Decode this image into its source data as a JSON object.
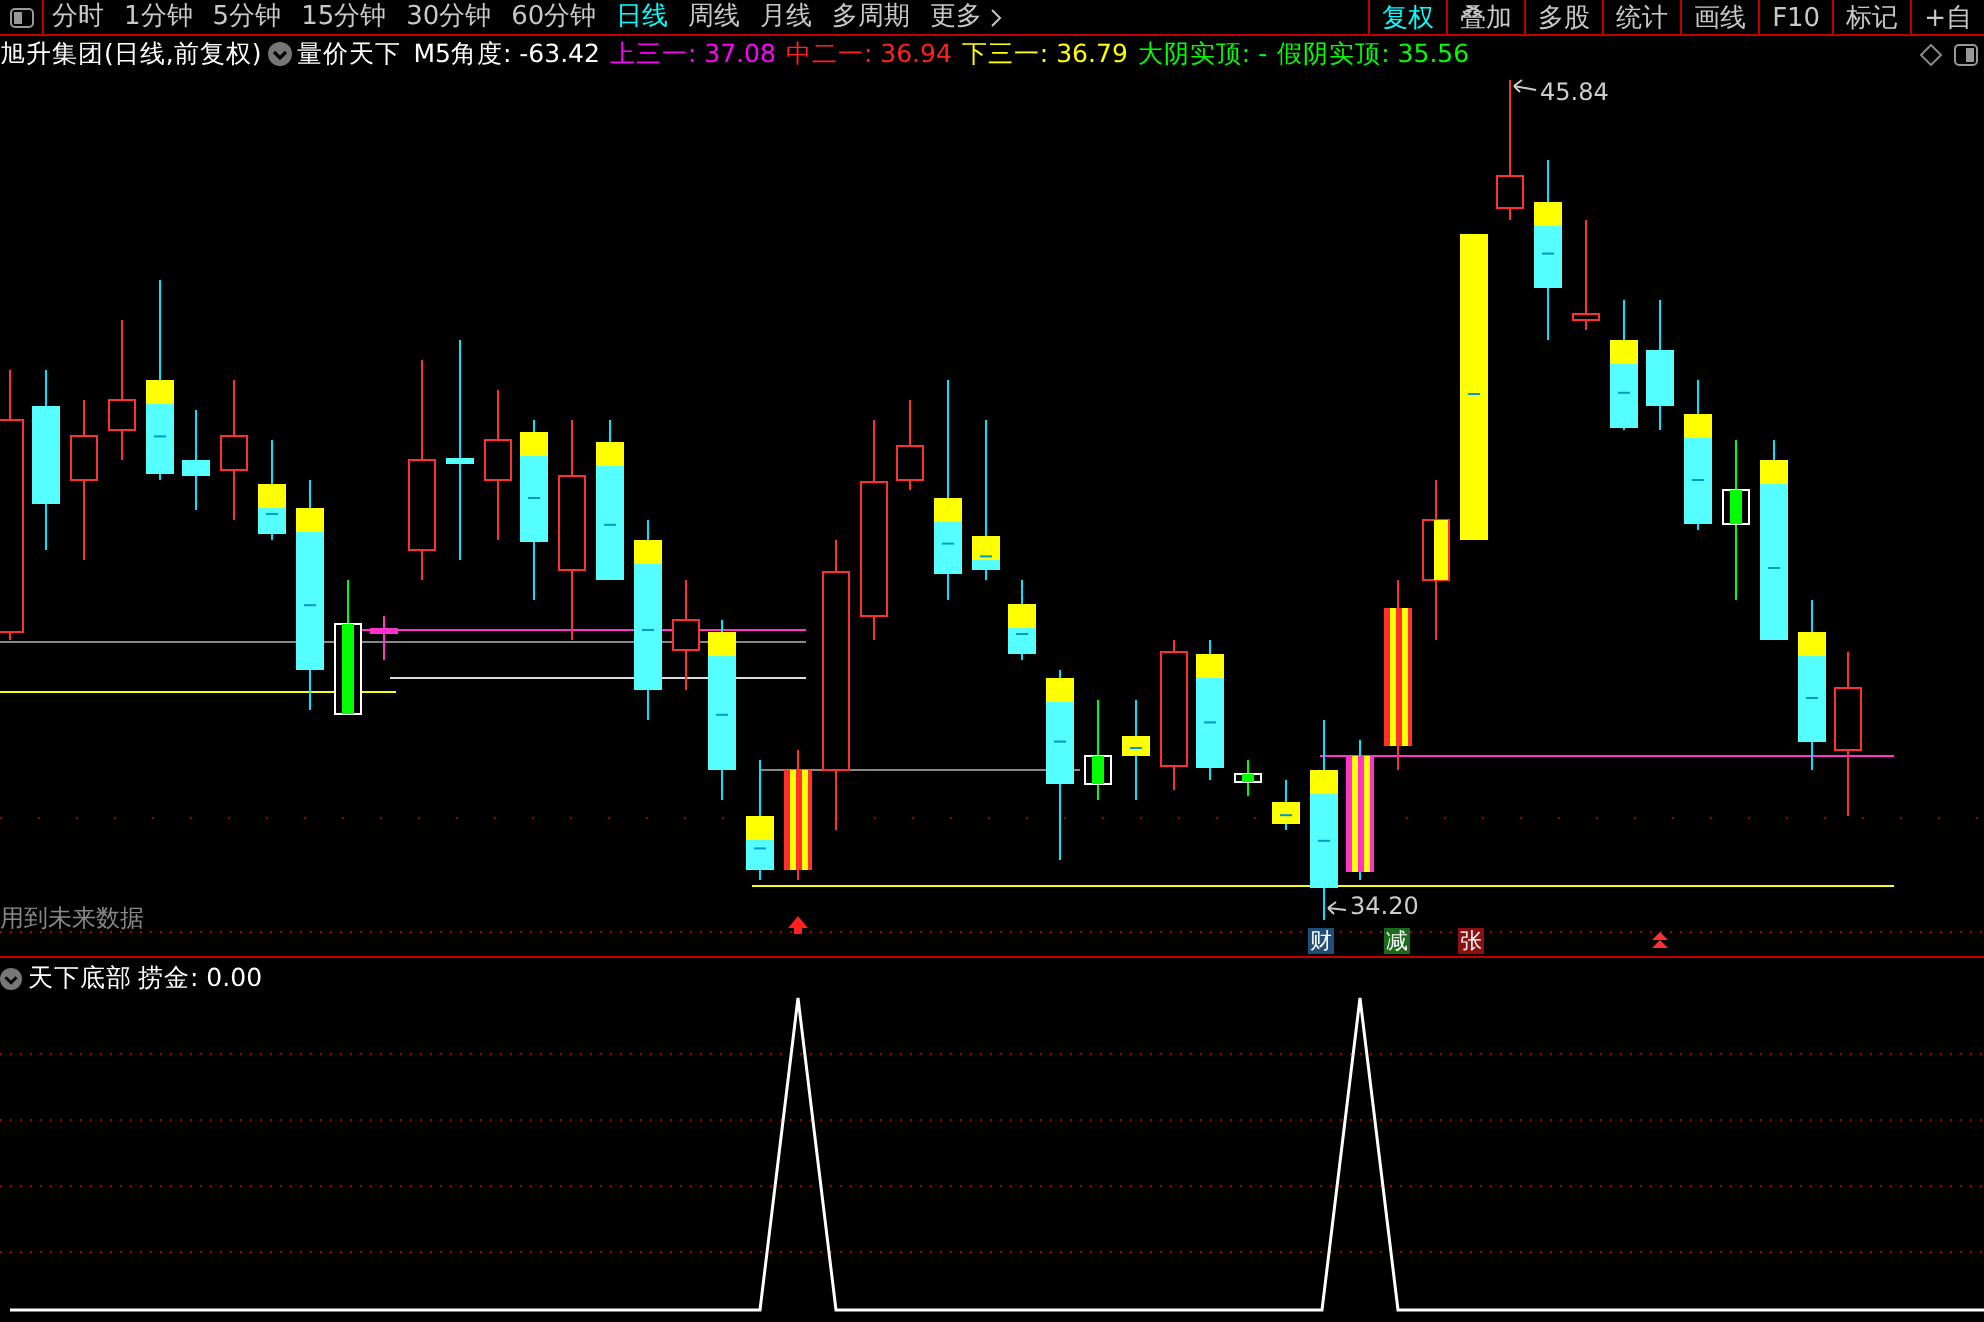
{
  "period_tabs": [
    {
      "label": "分时",
      "selected": false
    },
    {
      "label": "1分钟",
      "selected": false
    },
    {
      "label": "5分钟",
      "selected": false
    },
    {
      "label": "15分钟",
      "selected": false
    },
    {
      "label": "30分钟",
      "selected": false
    },
    {
      "label": "60分钟",
      "selected": false
    },
    {
      "label": "日线",
      "selected": true
    },
    {
      "label": "周线",
      "selected": false
    },
    {
      "label": "月线",
      "selected": false
    },
    {
      "label": "多周期",
      "selected": false
    },
    {
      "label": "更多",
      "selected": false
    }
  ],
  "tool_buttons": [
    {
      "label": "复权",
      "selected": true
    },
    {
      "label": "叠加",
      "selected": false
    },
    {
      "label": "多股",
      "selected": false
    },
    {
      "label": "统计",
      "selected": false
    },
    {
      "label": "画线",
      "selected": false
    },
    {
      "label": "F10",
      "selected": false
    },
    {
      "label": "标记",
      "selected": false
    },
    {
      "label": "+自",
      "selected": false
    }
  ],
  "info_line": {
    "title": "旭升集团(日线,前复权)",
    "indicator": "量价天下",
    "values": [
      {
        "label": "M5角度:",
        "value": "-63.42",
        "color": "#ffffff"
      },
      {
        "label": "上三一:",
        "value": "37.08",
        "color": "#ff00ff"
      },
      {
        "label": "中二一:",
        "value": "36.94",
        "color": "#ff2020"
      },
      {
        "label": "下三一:",
        "value": "36.79",
        "color": "#ffff00"
      },
      {
        "label": "大阴实顶:",
        "value": "-",
        "color": "#00ff00"
      },
      {
        "label": "假阴实顶:",
        "value": "35.56",
        "color": "#00ff00"
      }
    ]
  },
  "main_chart": {
    "high_label": "45.84",
    "low_label": "34.20",
    "note": "用到未来数据",
    "signals": [
      {
        "label": "财",
        "color": "#1f4e79"
      },
      {
        "label": "减",
        "color": "#1b6b1b"
      },
      {
        "label": "张",
        "color": "#8b1010"
      }
    ]
  },
  "sub_chart": {
    "name": "天下底部",
    "values": [
      {
        "label": "捞金:",
        "value": "0.00"
      }
    ]
  }
}
